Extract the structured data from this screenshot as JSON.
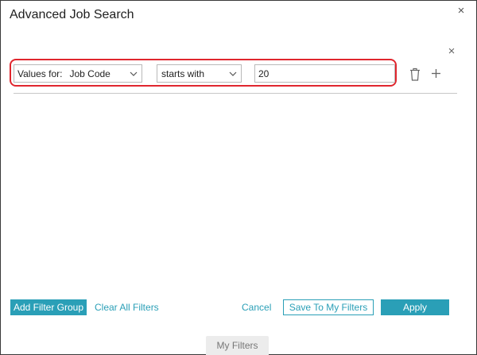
{
  "dialog": {
    "title": "Advanced Job Search",
    "close_glyph": "×"
  },
  "filter_row": {
    "remove_glyph": "×",
    "field_select": {
      "prefix": "Values for:",
      "value": "Job Code"
    },
    "operator_select": {
      "value": "starts with"
    },
    "value_input": {
      "value": "20"
    },
    "icons": {
      "delete": "trash-icon",
      "add": "plus-icon"
    }
  },
  "footer": {
    "add_filter_group_label": "Add Filter Group",
    "clear_all_label": "Clear All Filters",
    "cancel_label": "Cancel",
    "save_label": "Save To My Filters",
    "apply_label": "Apply"
  },
  "bottom_tab": {
    "label": "My Filters"
  },
  "colors": {
    "accent": "#2a9fb7",
    "highlight": "#e0262e",
    "tab_background": "#ececec"
  }
}
